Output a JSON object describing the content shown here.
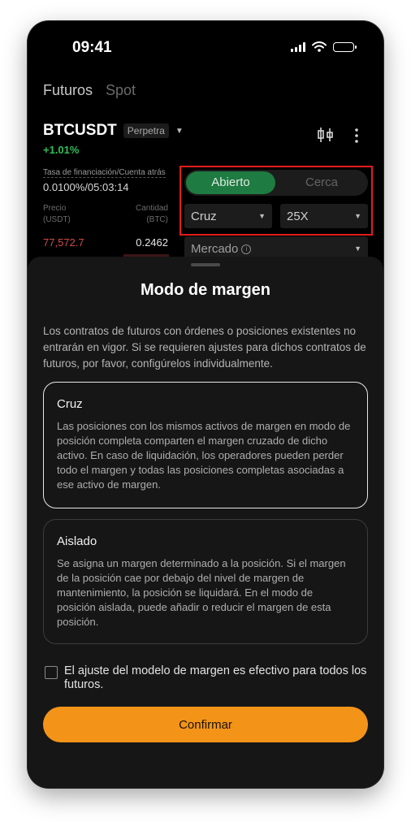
{
  "status_bar": {
    "time": "09:41"
  },
  "top_tabs": [
    "Futuros",
    "Spot"
  ],
  "pair": {
    "symbol": "BTCUSDT",
    "type_badge": "Perpetra",
    "change": "+1.01%"
  },
  "funding": {
    "label": "Tasa de financiación/Cuenta atrás",
    "value": "0.0100%/05:03:14"
  },
  "orderbook": {
    "price_header": "Precio\n(USDT)",
    "qty_header": "Cantidad\n(BTC)",
    "first_price": "77,572.7",
    "first_qty": "0.2462"
  },
  "order_panel": {
    "segment_open": "Abierto",
    "segment_close": "Cerca",
    "margin_mode": "Cruz",
    "leverage": "25X",
    "order_type": "Mercado"
  },
  "sheet": {
    "title": "Modo de margen",
    "description": "Los contratos de futuros con órdenes o posiciones existentes no entrarán en vigor. Si se requieren ajustes para dichos contratos de futuros, por favor, configúrelos individualmente.",
    "options": [
      {
        "title": "Cruz",
        "description": "Las posiciones con los mismos activos de margen en modo de posición completa comparten el margen cruzado de dicho activo. En caso de liquidación, los operadores pueden perder todo el margen y todas las posiciones completas asociadas a ese activo de margen."
      },
      {
        "title": "Aislado",
        "description": "Se asigna un margen determinado a la posición. Si el margen de la posición cae por debajo del nivel de margen de mantenimiento, la posición se liquidará. En el modo de posición aislada, puede añadir o reducir el margen de esta posición."
      }
    ],
    "checkbox_label": "El ajuste del modelo de margen es efectivo para todos los futuros.",
    "confirm_label": "Confirmar"
  },
  "colors": {
    "accent": "#f39419",
    "positive": "#2fbf5a",
    "negative": "#d04b4b",
    "open_green": "#1e7b41",
    "highlight": "#e31d1d"
  }
}
